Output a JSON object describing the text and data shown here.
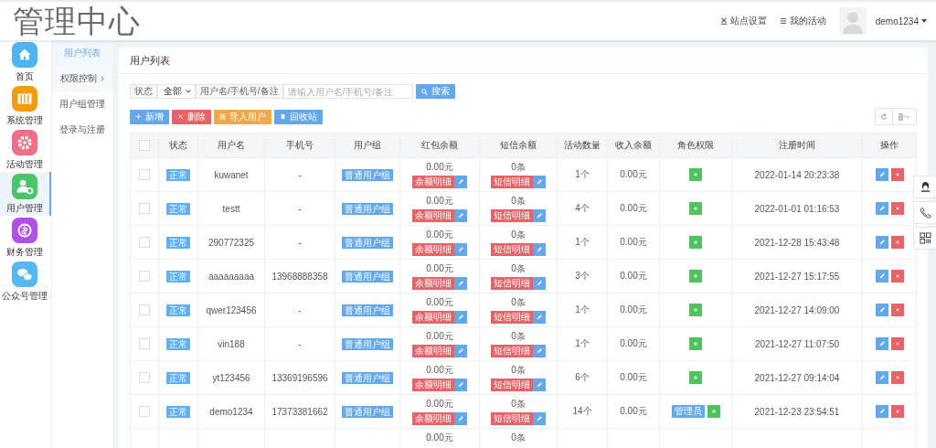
{
  "header": {
    "title": "管理中心",
    "links": [
      {
        "label": "站点设置"
      },
      {
        "label": "我的活动"
      }
    ],
    "user": "demo1234"
  },
  "sidebar": {
    "items": [
      {
        "label": "首页",
        "color": "#4fb3ef",
        "selected": false
      },
      {
        "label": "系统管理",
        "color": "#f39c12",
        "selected": false
      },
      {
        "label": "活动管理",
        "color": "#ef6f86",
        "selected": false
      },
      {
        "label": "用户管理",
        "color": "#4cc46a",
        "selected": true
      },
      {
        "label": "财务管理",
        "color": "#b050e8",
        "selected": false
      },
      {
        "label": "公众号管理",
        "color": "#55b8f0",
        "selected": false
      }
    ]
  },
  "submenu": [
    {
      "label": "用户列表",
      "selected": true,
      "expandable": false
    },
    {
      "label": "权限控制",
      "selected": false,
      "expandable": true
    },
    {
      "label": "用户组管理",
      "selected": false,
      "expandable": false
    },
    {
      "label": "登录与注册",
      "selected": false,
      "expandable": false
    }
  ],
  "card": {
    "title": "用户列表"
  },
  "filter": {
    "status_label": "状态",
    "status_value": "全部",
    "search_label": "用户名/手机号/备注",
    "placeholder": "请输入用户名/手机号/备注",
    "search_button": "搜索"
  },
  "actions": [
    {
      "label": "新增",
      "kind": "add"
    },
    {
      "label": "删除",
      "kind": "delete"
    },
    {
      "label": "导入用户",
      "kind": "import"
    },
    {
      "label": "回收站",
      "kind": "recycle"
    }
  ],
  "table": {
    "select_all_checked": false,
    "columns": [
      "状态",
      "用户名",
      "手机号",
      "用户组",
      "红包余额",
      "短信余额",
      "活动数量",
      "收入余额",
      "角色权限",
      "注册时间",
      "操作"
    ],
    "rows": [
      {
        "checked": false,
        "status": "正常",
        "username": "kuwanet",
        "phone": "-",
        "group": "普通用户组",
        "balance": "0.00元",
        "balance_button": "余额明细",
        "sms": "0条",
        "sms_button": "短信明细",
        "activities": "1个",
        "income": "0.00元",
        "roles": [],
        "registered": "2022-01-14 20:23:38"
      },
      {
        "checked": false,
        "status": "正常",
        "username": "testt",
        "phone": "-",
        "group": "普通用户组",
        "balance": "0.00元",
        "balance_button": "余额明细",
        "sms": "0条",
        "sms_button": "短信明细",
        "activities": "4个",
        "income": "0.00元",
        "roles": [],
        "registered": "2022-01-01 01:16:53"
      },
      {
        "checked": false,
        "status": "正常",
        "username": "290772325",
        "phone": "-",
        "group": "普通用户组",
        "balance": "0.00元",
        "balance_button": "余额明细",
        "sms": "0条",
        "sms_button": "短信明细",
        "activities": "1个",
        "income": "0.00元",
        "roles": [],
        "registered": "2021-12-28 15:43:48"
      },
      {
        "checked": false,
        "status": "正常",
        "username": "aaaaaaaaa",
        "phone": "13968888358",
        "group": "普通用户组",
        "balance": "0.00元",
        "balance_button": "余额明细",
        "sms": "0条",
        "sms_button": "短信明细",
        "activities": "3个",
        "income": "0.00元",
        "roles": [],
        "registered": "2021-12-27 15:17:55"
      },
      {
        "checked": false,
        "status": "正常",
        "username": "qwer123456",
        "phone": "-",
        "group": "普通用户组",
        "balance": "0.00元",
        "balance_button": "余额明细",
        "sms": "0条",
        "sms_button": "短信明细",
        "activities": "1个",
        "income": "0.00元",
        "roles": [],
        "registered": "2021-12-27 14:09:00"
      },
      {
        "checked": false,
        "status": "正常",
        "username": "vin188",
        "phone": "-",
        "group": "普通用户组",
        "balance": "0.00元",
        "balance_button": "余额明细",
        "sms": "0条",
        "sms_button": "短信明细",
        "activities": "1个",
        "income": "0.00元",
        "roles": [],
        "registered": "2021-12-27 11:07:50"
      },
      {
        "checked": false,
        "status": "正常",
        "username": "yt123456",
        "phone": "13369196596",
        "group": "普通用户组",
        "balance": "0.00元",
        "balance_button": "余额明细",
        "sms": "0条",
        "sms_button": "短信明细",
        "activities": "6个",
        "income": "0.00元",
        "roles": [],
        "registered": "2021-12-27 09:14:04"
      },
      {
        "checked": false,
        "status": "正常",
        "username": "demo1234",
        "phone": "17373381662",
        "group": "普通用户组",
        "balance": "0.00元",
        "balance_button": "余额明细",
        "sms": "0条",
        "sms_button": "短信明细",
        "activities": "14个",
        "income": "0.00元",
        "roles": [
          "管理员"
        ],
        "registered": "2021-12-23 23:54:51"
      }
    ],
    "partial_row": {
      "balance": "0.00元",
      "sms": "0条"
    }
  }
}
